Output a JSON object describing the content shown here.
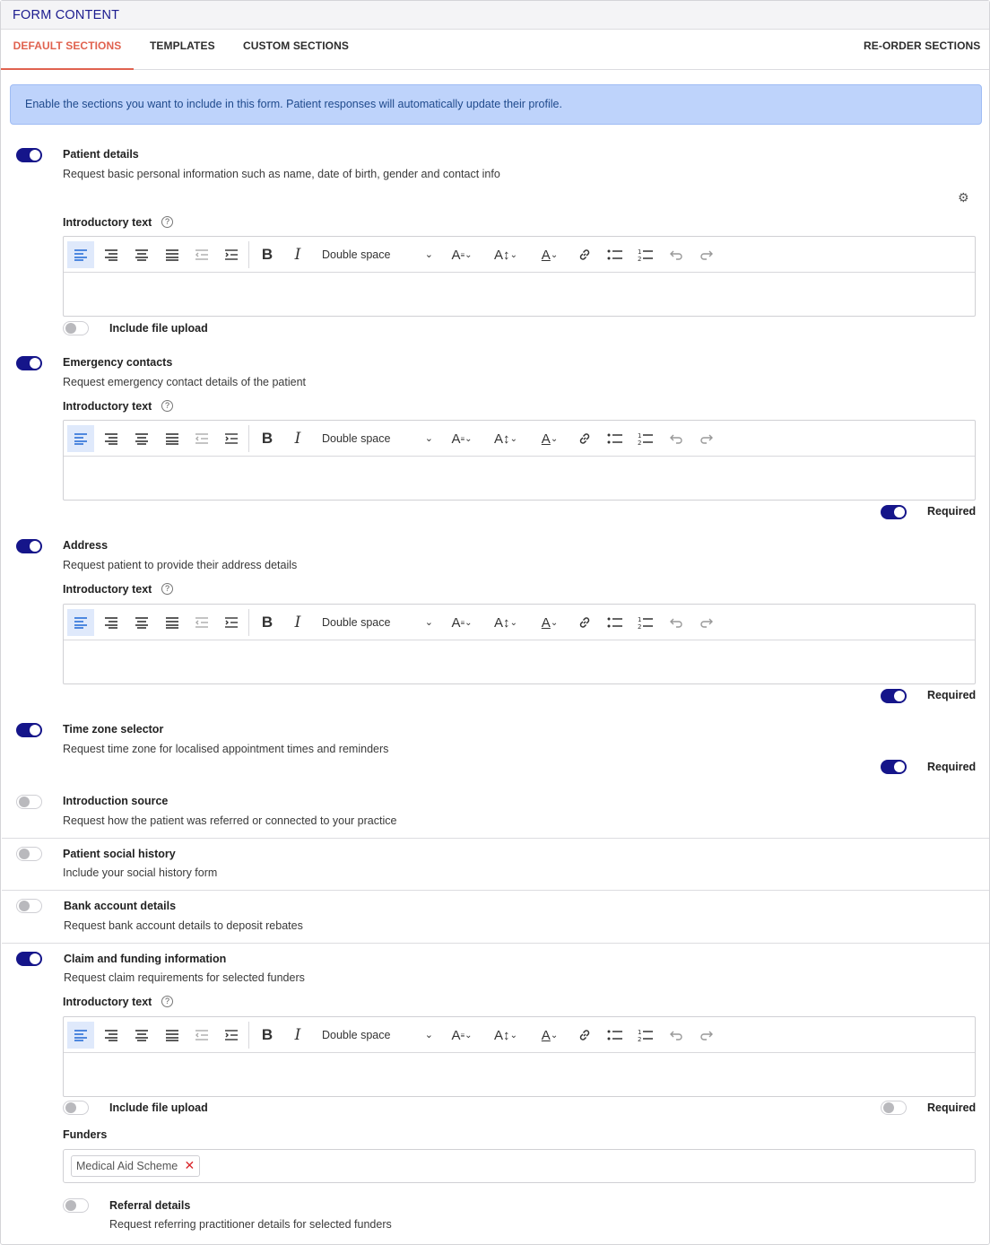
{
  "header": {
    "title": "FORM CONTENT"
  },
  "tabs": {
    "default": "DEFAULT SECTIONS",
    "templates": "TEMPLATES",
    "custom": "CUSTOM SECTIONS",
    "reorder": "RE-ORDER SECTIONS"
  },
  "banner": "Enable the sections you want to include in this form. Patient responses will automatically update their profile.",
  "labels": {
    "intro": "Introductory text",
    "file_upload": "Include file upload",
    "required": "Required",
    "funders": "Funders"
  },
  "editor": {
    "line_spacing": "Double space"
  },
  "sections": [
    {
      "title": "Patient details",
      "desc": "Request basic personal information such as name, date of birth, gender and contact info",
      "enabled": true
    },
    {
      "title": "Emergency contacts",
      "desc": "Request emergency contact details of the patient",
      "enabled": true
    },
    {
      "title": "Address",
      "desc": "Request patient to provide their address details",
      "enabled": true
    },
    {
      "title": "Time zone selector",
      "desc": "Request time zone for localised appointment times and reminders",
      "enabled": true
    },
    {
      "title": "Introduction source",
      "desc": "Request how the patient was referred or connected to your practice",
      "enabled": false
    },
    {
      "title": "Patient social history",
      "desc": "Include your social history form",
      "enabled": false
    },
    {
      "title": "Bank account details",
      "desc": "Request bank account details to deposit rebates",
      "enabled": false
    },
    {
      "title": "Claim and funding information",
      "desc": "Request claim requirements for selected funders",
      "enabled": true
    }
  ],
  "funders": {
    "chip": "Medical Aid Scheme"
  },
  "referral": {
    "title": "Referral details",
    "desc": "Request referring practitioner details for selected funders",
    "enabled": false
  },
  "colors": {
    "accent": "#e0624f",
    "toggle_on": "#15158a",
    "banner_bg": "#bed3fb",
    "title": "#1b1b8f"
  }
}
